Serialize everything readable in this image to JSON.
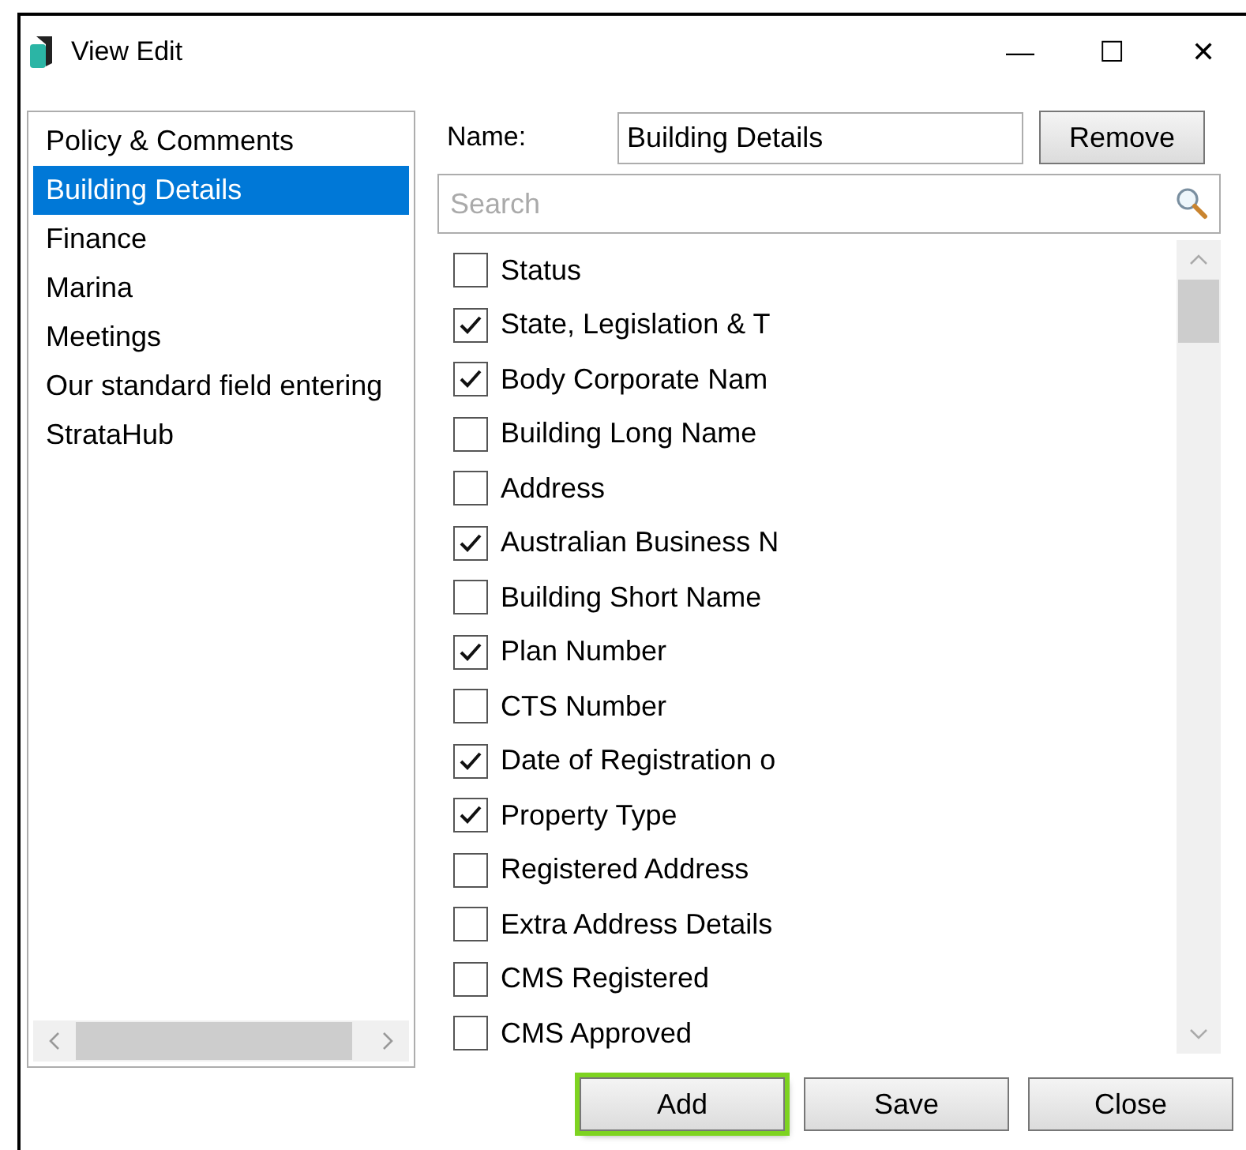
{
  "window": {
    "title": "View Edit",
    "controls": [
      "—",
      "☐",
      "✕"
    ]
  },
  "views": [
    {
      "label": "Policy & Comments",
      "selected": false
    },
    {
      "label": "Building Details",
      "selected": true
    },
    {
      "label": "Finance",
      "selected": false
    },
    {
      "label": "Marina",
      "selected": false
    },
    {
      "label": "Meetings",
      "selected": false
    },
    {
      "label": "Our standard field entering",
      "selected": false
    },
    {
      "label": "StrataHub",
      "selected": false
    }
  ],
  "name_field": {
    "label": "Name:",
    "value": "Building Details"
  },
  "remove_button": "Remove",
  "search": {
    "placeholder": "Search"
  },
  "fields": [
    {
      "label": "Status",
      "checked": false
    },
    {
      "label": "State, Legislation & T",
      "checked": true
    },
    {
      "label": "Body Corporate Nam",
      "checked": true
    },
    {
      "label": "Building Long Name",
      "checked": false
    },
    {
      "label": "Address",
      "checked": false
    },
    {
      "label": "Australian Business N",
      "checked": true
    },
    {
      "label": "Building Short Name",
      "checked": false
    },
    {
      "label": "Plan Number",
      "checked": true
    },
    {
      "label": "CTS Number",
      "checked": false
    },
    {
      "label": "Date of Registration o",
      "checked": true
    },
    {
      "label": "Property Type",
      "checked": true
    },
    {
      "label": "Registered Address",
      "checked": false
    },
    {
      "label": "Extra Address Details",
      "checked": false
    },
    {
      "label": "CMS Registered",
      "checked": false
    },
    {
      "label": "CMS Approved",
      "checked": false
    }
  ],
  "buttons": [
    {
      "label": "Add",
      "highlighted": true
    },
    {
      "label": "Save",
      "highlighted": false
    },
    {
      "label": "Close",
      "highlighted": false
    }
  ]
}
